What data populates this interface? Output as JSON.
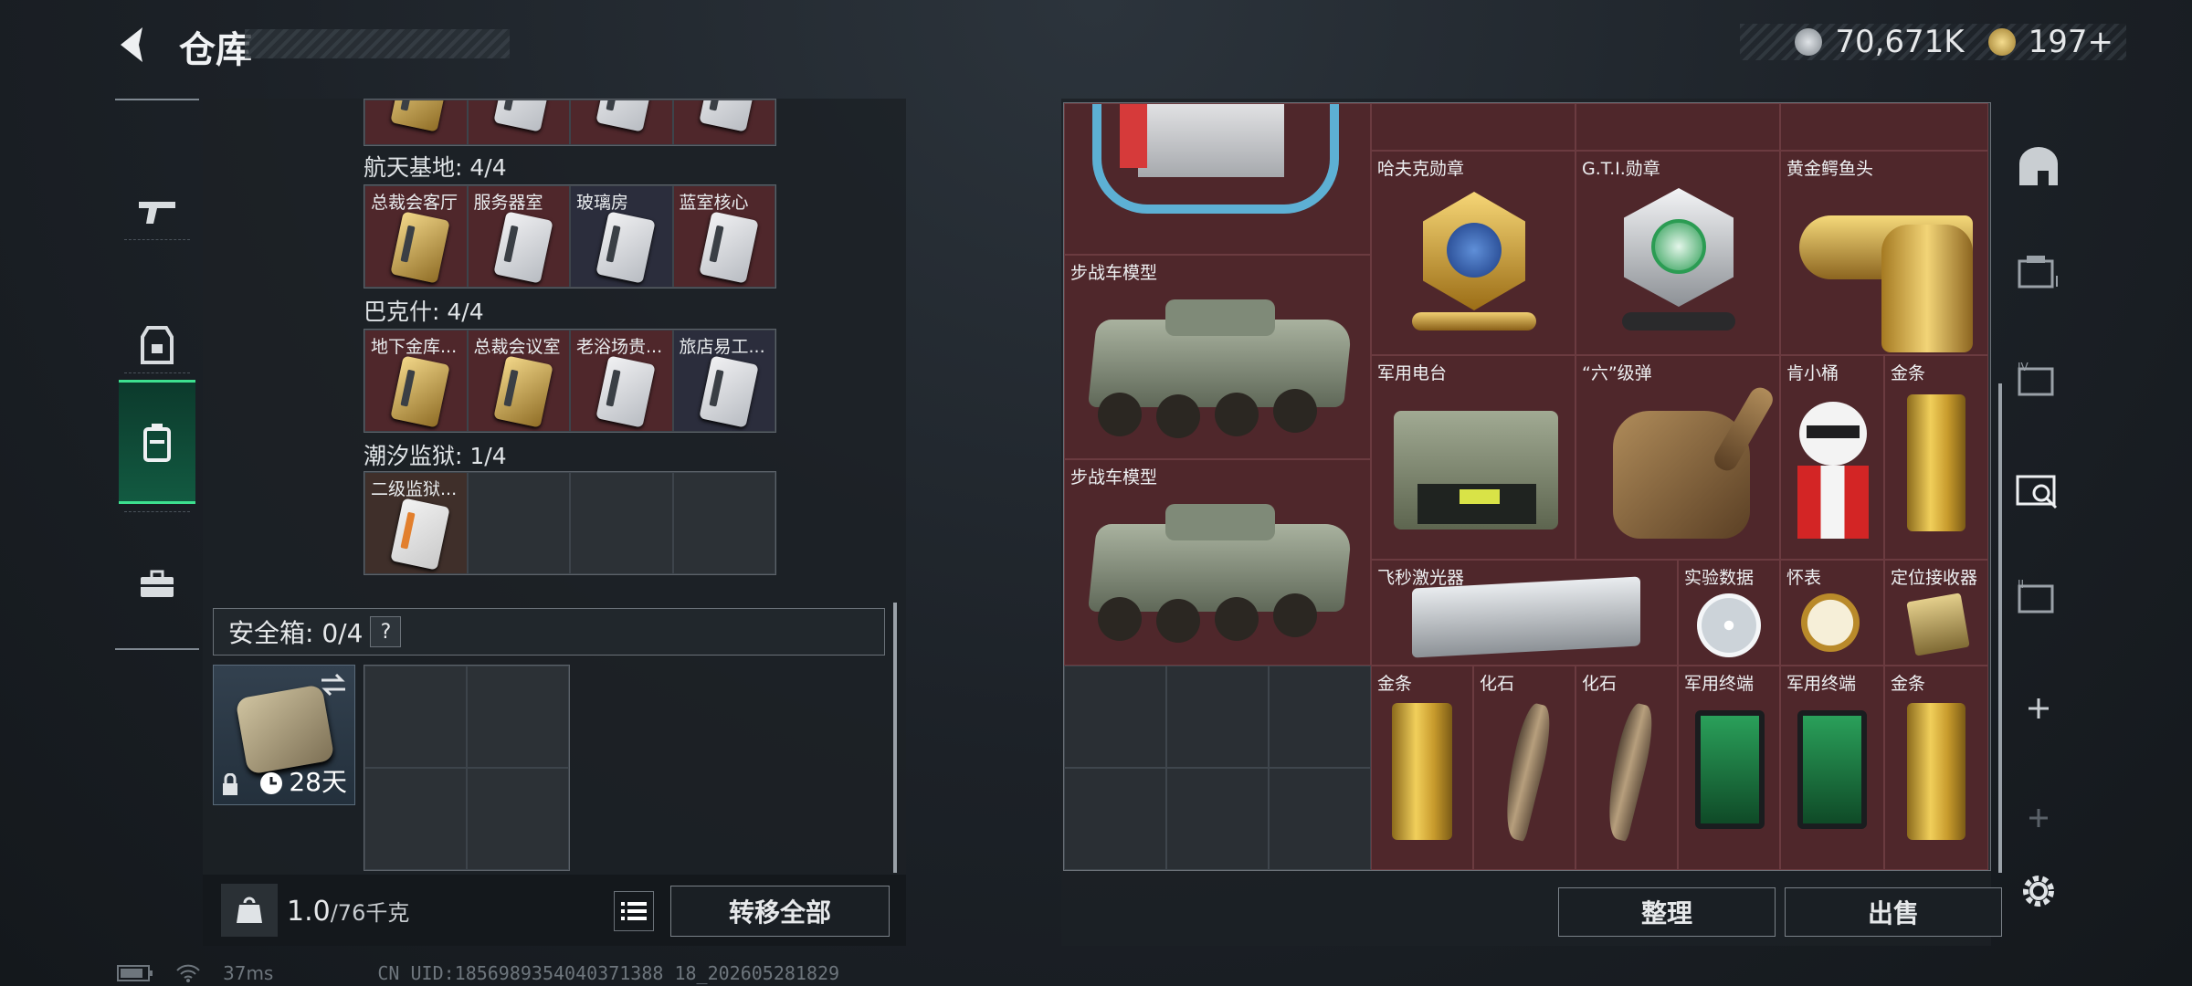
{
  "header": {
    "title": "仓库",
    "currency_main": "70,671K",
    "currency_alt": "197+"
  },
  "left_nav": [
    "gun-icon",
    "armor-icon",
    "backpack-icon",
    "briefcase-icon"
  ],
  "keycards": {
    "partial_row": [
      "",
      "",
      "",
      ""
    ],
    "groups": [
      {
        "label": "航天基地: 4/4",
        "items": [
          "总裁会客厅",
          "服务器室",
          "玻璃房",
          "蓝室核心"
        ]
      },
      {
        "label": "巴克什: 4/4",
        "items": [
          "地下金库...",
          "总裁会议室",
          "老浴场贵...",
          "旅店易工..."
        ]
      },
      {
        "label": "潮汐监狱: 1/4",
        "items": [
          "二级监狱..."
        ]
      }
    ]
  },
  "safe": {
    "label": "安全箱: 0/4",
    "help": "?",
    "duration": "28天"
  },
  "footer_left": {
    "weight": "1.0",
    "weight_cap": "/76千克",
    "transfer_all": "转移全部"
  },
  "stash": [
    {
      "name": ""
    },
    {
      "name": "哈夫克勋章"
    },
    {
      "name": "G.T.I.勋章"
    },
    {
      "name": "黄金鳄鱼头"
    },
    {
      "name": "步战车模型"
    },
    {
      "name": "步战车模型"
    },
    {
      "name": "军用电台"
    },
    {
      "name": "“六”级弹"
    },
    {
      "name": "肯小桶"
    },
    {
      "name": "金条"
    },
    {
      "name": "飞秒激光器"
    },
    {
      "name": "实验数据"
    },
    {
      "name": "怀表"
    },
    {
      "name": "定位接收器"
    },
    {
      "name": "金条"
    },
    {
      "name": "化石"
    },
    {
      "name": "化石"
    },
    {
      "name": "军用终端"
    },
    {
      "name": "军用终端"
    },
    {
      "name": "金条"
    }
  ],
  "right_actions": {
    "sort": "整理",
    "sell": "出售"
  },
  "right_nav": [
    "home-icon",
    "stash-tab-1-icon",
    "stash-tab-4-icon",
    "stash-tab-sell-icon",
    "stash-tab-2-icon",
    "add-tab-icon",
    "add-tab-disabled-icon",
    "settings-icon"
  ],
  "status": {
    "ping": "37ms",
    "uid": "CN UID:1856989354040371388 18_202605281829"
  },
  "colors": {
    "accent_green": "#3de08f",
    "item_red": "#4f272b",
    "gold": "#f1cf5b"
  }
}
